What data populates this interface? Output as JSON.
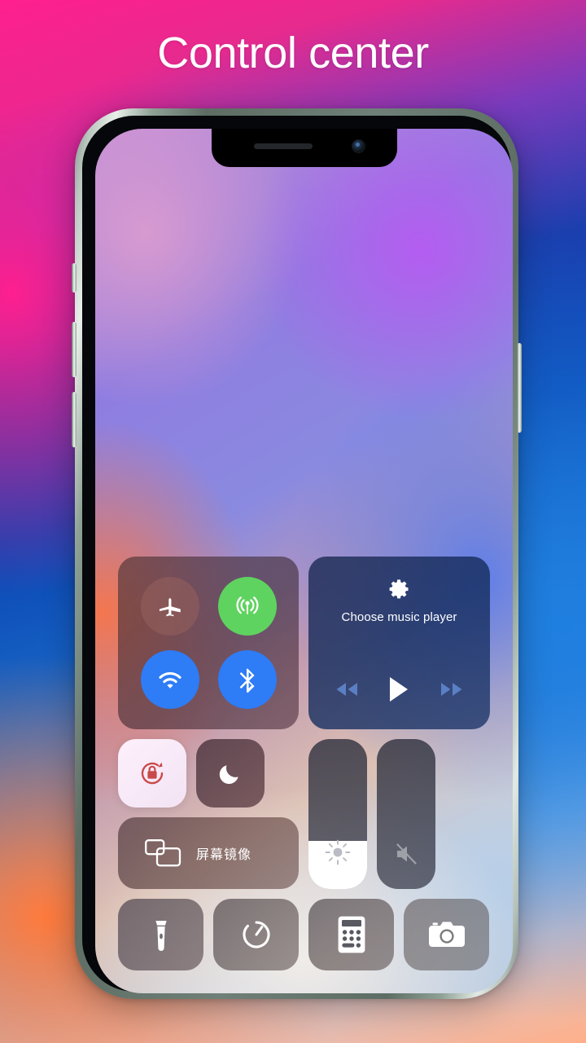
{
  "page": {
    "title": "Control center",
    "title_color": "#ffffff"
  },
  "device": {
    "frame_color": "#6f8078",
    "notch": {
      "speaker_name": "earpiece-speaker",
      "camera_name": "front-camera"
    },
    "buttons": {
      "mute_switch": "Mute switch",
      "volume_up": "Volume up",
      "volume_down": "Volume down",
      "power": "Side button"
    }
  },
  "control_center": {
    "connectivity": {
      "toggles": [
        {
          "name": "airplane-mode",
          "icon": "airplane-icon",
          "state": "off",
          "color": "#96605c"
        },
        {
          "name": "cellular-data",
          "icon": "cellular-icon",
          "state": "on",
          "color": "#5fd35f"
        },
        {
          "name": "wifi",
          "icon": "wifi-icon",
          "state": "on",
          "color": "#2e7cf6"
        },
        {
          "name": "bluetooth",
          "icon": "bluetooth-icon",
          "state": "on",
          "color": "#2e7cf6"
        }
      ]
    },
    "music": {
      "settings_icon": "gear-icon",
      "label": "Choose music player",
      "controls": [
        {
          "name": "previous-track",
          "icon": "rewind-icon",
          "state": "dimmed"
        },
        {
          "name": "play",
          "icon": "play-icon",
          "state": "active"
        },
        {
          "name": "next-track",
          "icon": "fast-forward-icon",
          "state": "dimmed"
        }
      ]
    },
    "rotation_lock": {
      "icon": "rotation-lock-icon",
      "state": "on",
      "icon_color": "#c94a4a"
    },
    "do_not_disturb": {
      "icon": "moon-icon",
      "state": "off"
    },
    "screen_mirroring": {
      "icon": "screen-mirroring-icon",
      "label": "屏幕镜像"
    },
    "brightness": {
      "icon": "sun-icon",
      "value": 32,
      "unit": "%"
    },
    "volume": {
      "icon": "mute-speaker-icon",
      "value": 0,
      "unit": "%"
    },
    "shortcuts": [
      {
        "name": "flashlight",
        "icon": "flashlight-icon"
      },
      {
        "name": "timer",
        "icon": "timer-icon"
      },
      {
        "name": "calculator",
        "icon": "calculator-icon"
      },
      {
        "name": "camera",
        "icon": "camera-icon"
      }
    ]
  }
}
